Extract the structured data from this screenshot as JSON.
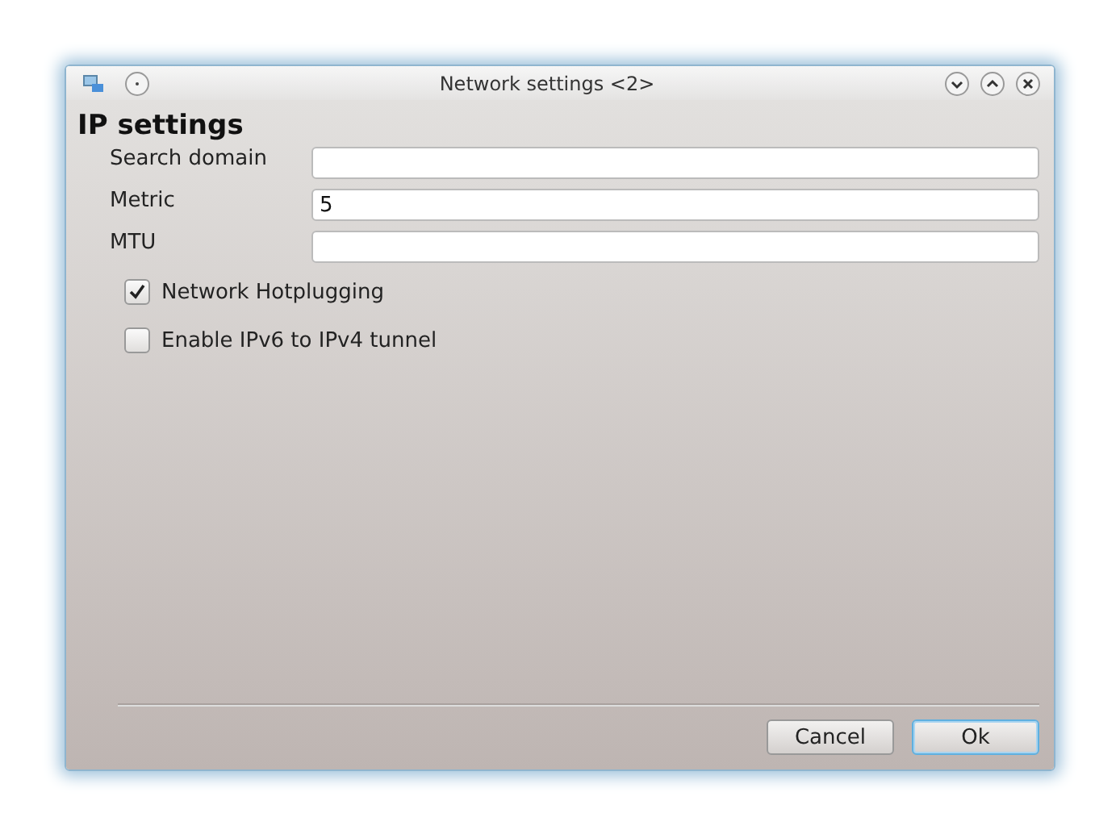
{
  "window": {
    "title": "Network settings <2>"
  },
  "heading": "IP settings",
  "fields": [
    {
      "label": "Search domain"
    },
    {
      "label": "Metric",
      "value": "5"
    },
    {
      "label": "MTU"
    }
  ],
  "checkboxes": [
    {
      "label": "Network Hotplugging",
      "checked": true
    },
    {
      "label": "Enable IPv6 to IPv4 tunnel",
      "checked": false
    }
  ],
  "buttons": [
    {
      "label": "Cancel",
      "selected": false
    },
    {
      "label": "Ok",
      "selected": true
    }
  ]
}
